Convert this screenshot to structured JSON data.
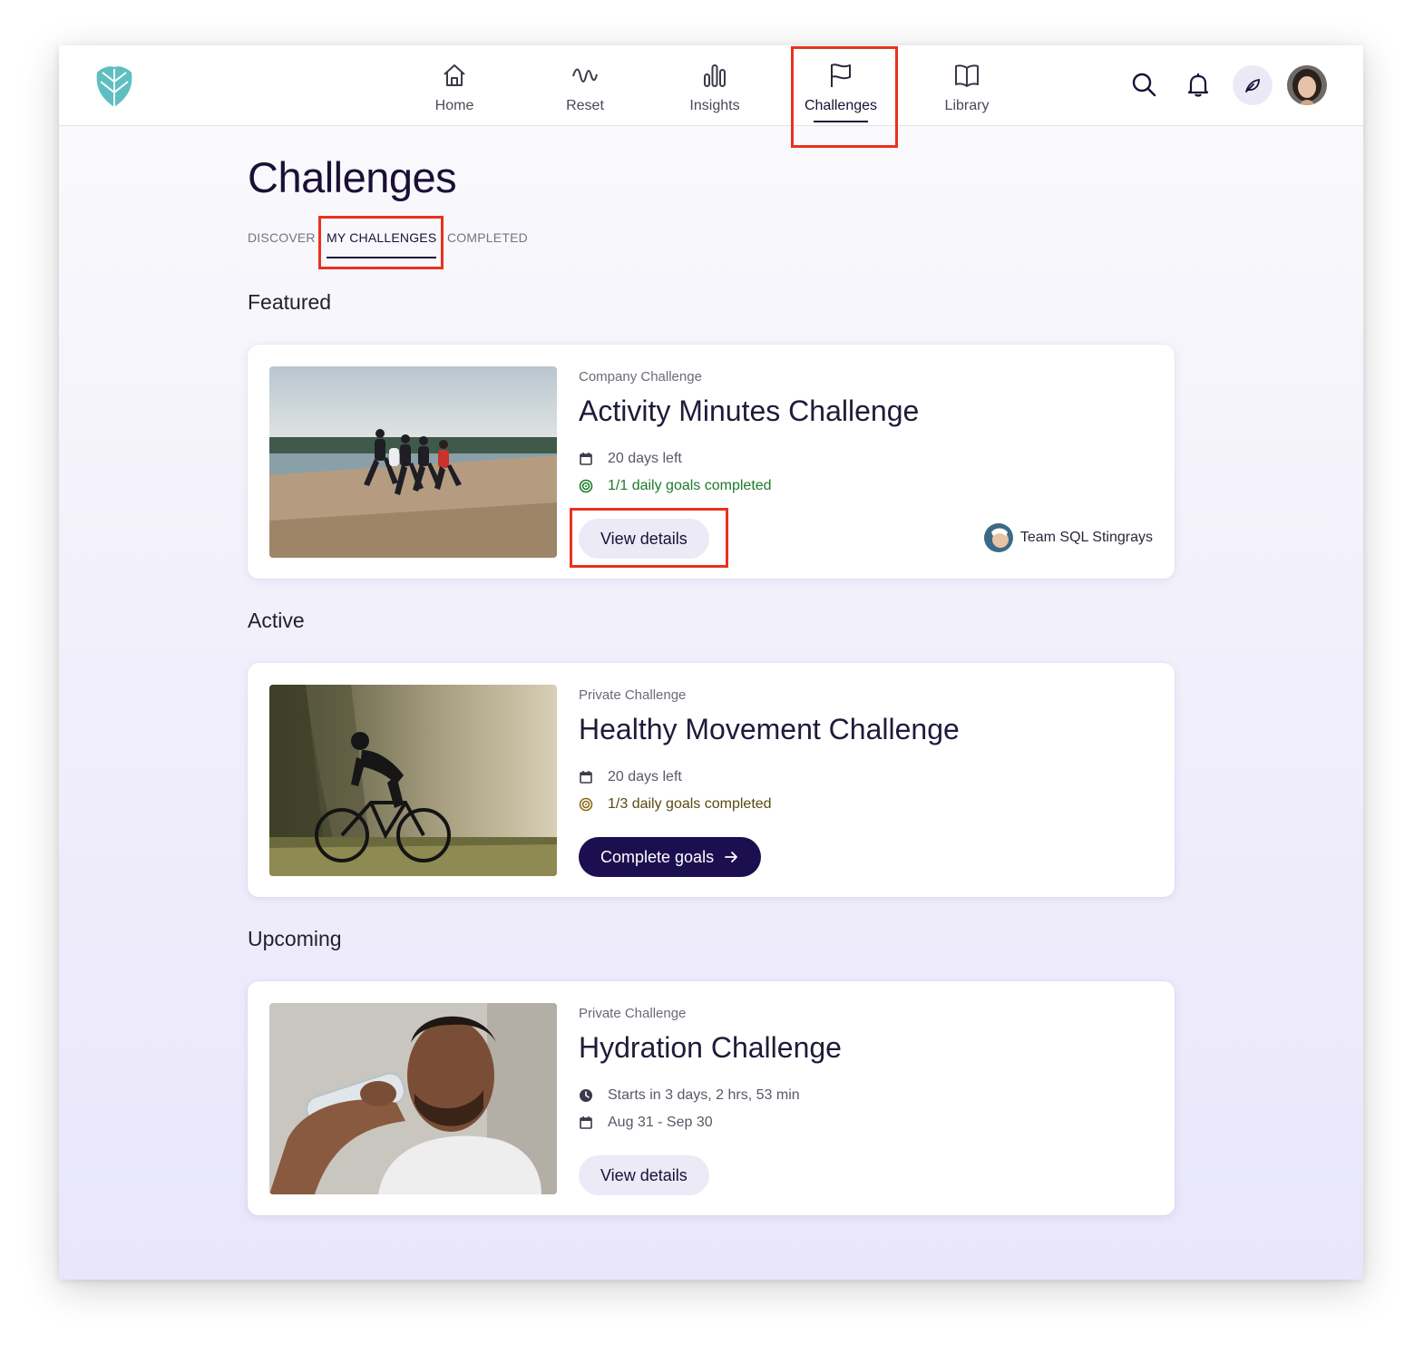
{
  "nav": {
    "items": [
      {
        "label": "Home",
        "icon": "home-icon"
      },
      {
        "label": "Reset",
        "icon": "wave-icon"
      },
      {
        "label": "Insights",
        "icon": "bar-chart-icon"
      },
      {
        "label": "Challenges",
        "icon": "flag-icon",
        "active": true
      },
      {
        "label": "Library",
        "icon": "book-icon"
      }
    ],
    "right_icons": [
      "search-icon",
      "bell-icon",
      "leaf-icon",
      "avatar"
    ]
  },
  "page": {
    "title": "Challenges",
    "tabs": [
      {
        "label": "DISCOVER"
      },
      {
        "label": "MY CHALLENGES",
        "active": true
      },
      {
        "label": "COMPLETED"
      }
    ]
  },
  "sections": {
    "featured": "Featured",
    "active": "Active",
    "upcoming": "Upcoming"
  },
  "cards": [
    {
      "type": "Company Challenge",
      "title": "Activity Minutes Challenge",
      "meta": [
        "20 days left",
        "1/1 daily goals completed"
      ],
      "button": "View details",
      "team": "Team SQL Stingrays"
    },
    {
      "type": "Private Challenge",
      "title": "Healthy Movement Challenge",
      "meta": [
        "20 days left",
        "1/3 daily goals completed"
      ],
      "button": "Complete goals"
    },
    {
      "type": "Private Challenge",
      "title": "Hydration Challenge",
      "meta": [
        "Starts in 3 days, 2 hrs, 53 min",
        "Aug 31 - Sep 30"
      ],
      "button": "View details"
    }
  ],
  "colors": {
    "accent_dark": "#1c0f4f",
    "highlight": "#e8321f",
    "success": "#1f7a2a",
    "logo": "#5fbfc0"
  }
}
